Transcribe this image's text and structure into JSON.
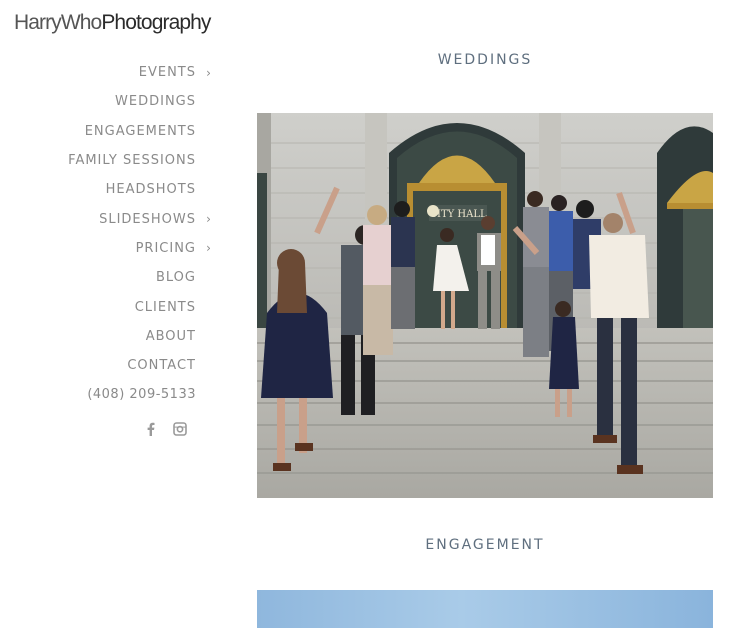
{
  "logo": {
    "part1": "HarryWho",
    "part2": "Photography"
  },
  "nav": {
    "items": [
      {
        "label": "EVENTS",
        "has_submenu": true
      },
      {
        "label": "WEDDINGS",
        "has_submenu": false
      },
      {
        "label": "ENGAGEMENTS",
        "has_submenu": false
      },
      {
        "label": "FAMILY SESSIONS",
        "has_submenu": false
      },
      {
        "label": "HEADSHOTS",
        "has_submenu": false
      },
      {
        "label": "SLIDESHOWS",
        "has_submenu": true
      },
      {
        "label": "PRICING",
        "has_submenu": true
      },
      {
        "label": "BLOG",
        "has_submenu": false
      },
      {
        "label": "CLIENTS",
        "has_submenu": false
      },
      {
        "label": "ABOUT",
        "has_submenu": false
      },
      {
        "label": "CONTACT",
        "has_submenu": false
      },
      {
        "label": "(408) 209-5133",
        "has_submenu": false
      }
    ],
    "chevron": "›"
  },
  "social": {
    "icons": [
      "facebook-icon",
      "instagram-icon"
    ]
  },
  "sections": [
    {
      "title": "WEDDINGS",
      "photo_sign": "CITY HALL"
    },
    {
      "title": "ENGAGEMENT"
    }
  ],
  "colors": {
    "nav_text": "#8a8a8a",
    "section_title": "#5f6f7f",
    "logo_text": "#2e2e2e"
  }
}
